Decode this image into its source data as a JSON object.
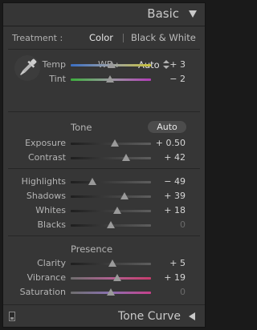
{
  "panel": {
    "title": "Basic",
    "footer_title": "Tone Curve"
  },
  "treatment": {
    "label": "Treatment :",
    "options": [
      "Color",
      "Black & White"
    ],
    "selected": "Color"
  },
  "white_balance": {
    "label": "WB :",
    "value": "Auto",
    "icons": {
      "dropper": "eyedropper-icon",
      "arrows": "up-down-arrows-icon"
    }
  },
  "sections": {
    "tone_label": "Tone",
    "auto_label": "Auto",
    "presence_label": "Presence"
  },
  "sliders": [
    {
      "id": "temp",
      "label": "Temp",
      "value": "+ 3",
      "position": 0.51,
      "track": "temp"
    },
    {
      "id": "tint",
      "label": "Tint",
      "value": "− 2",
      "position": 0.49,
      "track": "tint"
    },
    {
      "id": "exposure",
      "label": "Exposure",
      "value": "+ 0.50",
      "position": 0.55,
      "track": "plain"
    },
    {
      "id": "contrast",
      "label": "Contrast",
      "value": "+ 42",
      "position": 0.69,
      "track": "plain"
    },
    {
      "id": "highlights",
      "label": "Highlights",
      "value": "− 49",
      "position": 0.27,
      "track": "plain"
    },
    {
      "id": "shadows",
      "label": "Shadows",
      "value": "+ 39",
      "position": 0.67,
      "track": "plain"
    },
    {
      "id": "whites",
      "label": "Whites",
      "value": "+ 18",
      "position": 0.58,
      "track": "plain"
    },
    {
      "id": "blacks",
      "label": "Blacks",
      "value": "0",
      "position": 0.5,
      "track": "plain"
    },
    {
      "id": "clarity",
      "label": "Clarity",
      "value": "+ 5",
      "position": 0.52,
      "track": "plain"
    },
    {
      "id": "vibrance",
      "label": "Vibrance",
      "value": "+ 19",
      "position": 0.58,
      "track": "vibrance"
    },
    {
      "id": "saturation",
      "label": "Saturation",
      "value": "0",
      "position": 0.5,
      "track": "saturation"
    }
  ],
  "colors": {
    "panel_bg": "#363636",
    "selected_text": "#e6e6e6",
    "thumb": "#9a9a9a"
  }
}
